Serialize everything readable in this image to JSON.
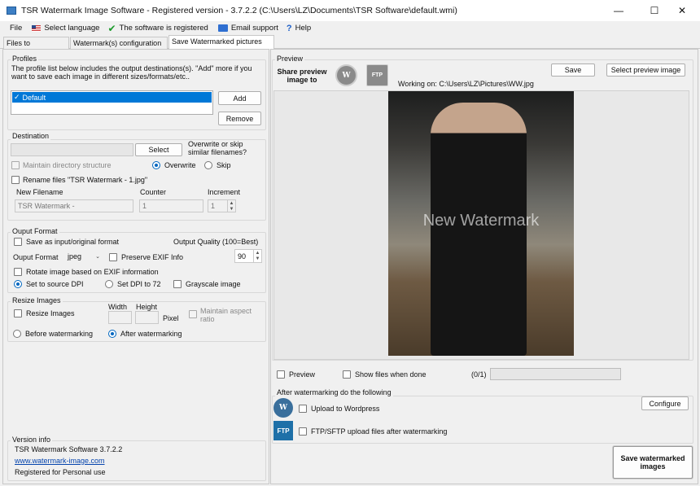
{
  "window": {
    "title": "TSR Watermark Image Software - Registered version - 3.7.2.2 (C:\\Users\\LZ\\Documents\\TSR Software\\default.wmi)"
  },
  "menu": {
    "file": "File",
    "language": "Select language",
    "registered": "The software is registered",
    "email": "Email support",
    "help": "Help"
  },
  "tabs": [
    "Files to watermark",
    "Watermark(s) configuration",
    "Save Watermarked pictures as"
  ],
  "profiles": {
    "label": "Profiles",
    "description": "The profile list below includes the output destinations(s). \"Add\" more if you want to save each image in different sizes/formats/etc..",
    "items": [
      "Default"
    ],
    "add": "Add",
    "remove": "Remove"
  },
  "destination": {
    "label": "Destination",
    "select": "Select",
    "overwrite_question": "Overwrite or skip similar filenames?",
    "maintain": "Maintain directory structure",
    "overwrite": "Overwrite",
    "skip": "Skip",
    "rename": "Rename files \"TSR Watermark - 1.jpg\"",
    "new_filename_label": "New Filename",
    "counter_label": "Counter",
    "increment_label": "Increment",
    "new_filename": "TSR Watermark -",
    "counter": "1",
    "increment": "1"
  },
  "output": {
    "label": "Ouput Format",
    "save_as_input": "Save as input/original format",
    "quality_label": "Output Quality (100=Best)",
    "format_label": "Ouput Format",
    "format": "jpeg",
    "preserve_exif": "Preserve EXIF Info",
    "quality": "90",
    "rotate": "Rotate image based on EXIF information",
    "source_dpi": "Set to source DPI",
    "dpi72": "Set DPI to 72",
    "grayscale": "Grayscale image"
  },
  "resize": {
    "label": "Resize Images",
    "resize": "Resize Images",
    "width": "Width",
    "height": "Height",
    "pixel": "Pixel",
    "maintain": "Maintain aspect ratio",
    "before": "Before watermarking",
    "after": "After watermarking"
  },
  "version": {
    "label": "Version info",
    "name": "TSR Watermark Software 3.7.2.2",
    "url": "www.watermark-image.com",
    "registered": "Registered for Personal use"
  },
  "preview": {
    "label": "Preview",
    "share": "Share preview image to",
    "save": "Save",
    "select_preview": "Select preview image",
    "working": "Working on: C:\\Users\\LZ\\Pictures\\WW.jpg",
    "watermark": "New Watermark",
    "preview_cb": "Preview",
    "show_files": "Show files when done",
    "progress": "(0/1)",
    "progress_fraction": 0
  },
  "after": {
    "label": "After watermarking do the following",
    "wordpress": "Upload to Wordpress",
    "ftp": "FTP/SFTP upload files after watermarking",
    "configure": "Configure",
    "save_button": "Save watermarked images"
  },
  "icons": {
    "app": "app-icon",
    "flag": "us-flag-icon",
    "check": "green-check-icon",
    "email": "email-icon",
    "help": "help-icon",
    "wordpress": "wordpress-icon",
    "ftp": "ftp-icon"
  },
  "labels": {
    "ftp_icon": "FTP",
    "wp_icon": "W"
  }
}
